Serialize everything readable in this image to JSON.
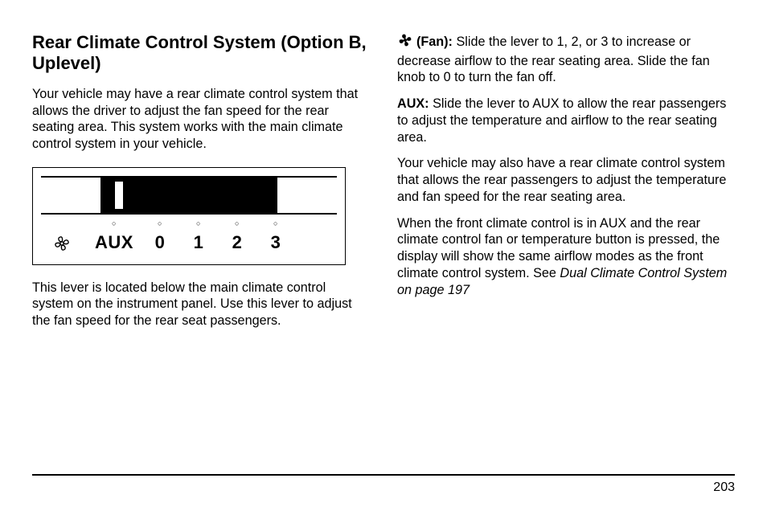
{
  "heading": "Rear Climate Control System (Option B, Uplevel)",
  "left": {
    "p1": "Your vehicle may have a rear climate control system that allows the driver to adjust the fan speed for the rear seating area. This system works with the main climate control system in your vehicle.",
    "p2": "This lever is located below the main climate control system on the instrument panel. Use this lever to adjust the fan speed for the rear seat passengers."
  },
  "diagram": {
    "aux_label": "AUX",
    "positions": [
      "0",
      "1",
      "2",
      "3"
    ]
  },
  "right": {
    "fan_label": "(Fan):",
    "fan_text": " Slide the lever to 1, 2, or 3 to increase or decrease airflow to the rear seating area. Slide the fan knob to 0 to turn the fan off.",
    "aux_label": "AUX:",
    "aux_text": " Slide the lever to AUX to allow the rear passengers to adjust the temperature and airflow to the rear seating area.",
    "p3": "Your vehicle may also have a rear climate control system that allows the rear passengers to adjust the temperature and fan speed for the rear seating area.",
    "p4a": "When the front climate control is in AUX and the rear climate control fan or temperature button is pressed, the display will show the same airflow modes as the front climate control system. See ",
    "p4_ref": "Dual Climate Control System on page 197"
  },
  "page_number": "203"
}
